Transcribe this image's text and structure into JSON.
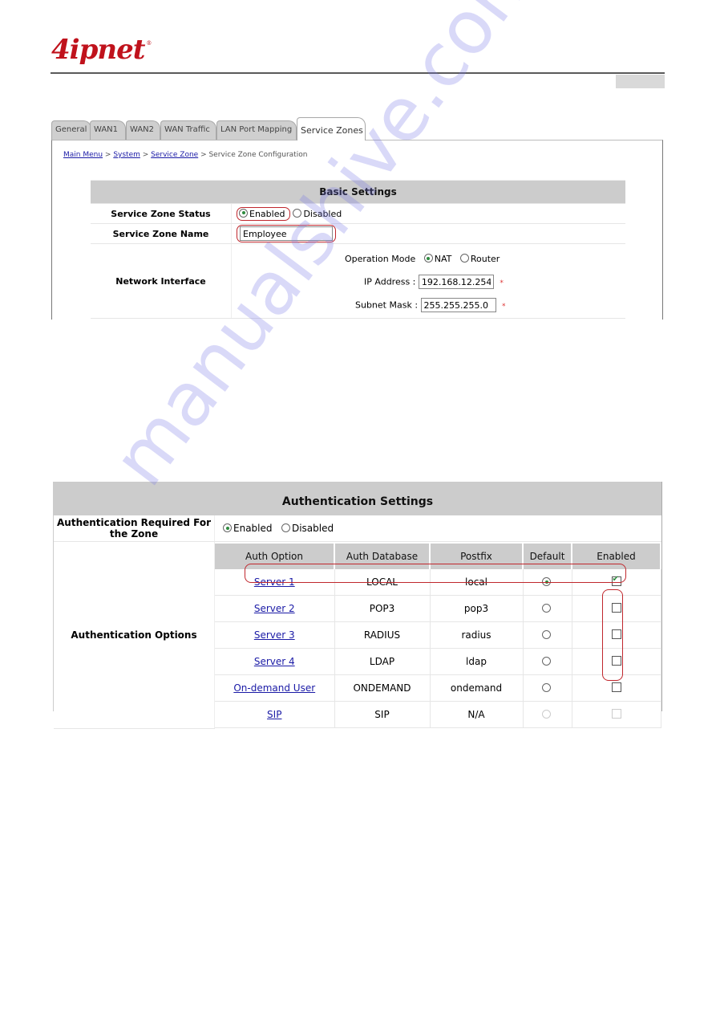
{
  "header": {
    "logo_text": "4ipnet",
    "logo_mark": "®",
    "brand_color": "#c0121c"
  },
  "screen1": {
    "tabs": [
      {
        "label": "General",
        "active": false
      },
      {
        "label": "WAN1",
        "active": false
      },
      {
        "label": "WAN2",
        "active": false
      },
      {
        "label": "WAN Traffic",
        "active": false
      },
      {
        "label": "LAN Port Mapping",
        "active": false
      },
      {
        "label": "Service Zones",
        "active": true
      }
    ],
    "breadcrumb": {
      "links": [
        "Main Menu",
        "System",
        "Service Zone"
      ],
      "separator": " > ",
      "current": "Service Zone Configuration"
    },
    "basic_settings": {
      "title": "Basic Settings",
      "status": {
        "label": "Service Zone Status",
        "options": [
          "Enabled",
          "Disabled"
        ],
        "selected": "Enabled"
      },
      "name": {
        "label": "Service Zone Name",
        "value": "Employee"
      },
      "network": {
        "label": "Network Interface",
        "operation_mode_label": "Operation Mode",
        "operation_mode_options": [
          "NAT",
          "Router"
        ],
        "operation_mode_selected": "NAT",
        "ip_label": "IP Address :",
        "ip_value": "192.168.12.254",
        "mask_label": "Subnet Mask :",
        "mask_value": "255.255.255.0",
        "required_mark": "*"
      }
    }
  },
  "screen2": {
    "title": "Authentication Settings",
    "required": {
      "label": "Authentication Required For the Zone",
      "options": [
        "Enabled",
        "Disabled"
      ],
      "selected": "Enabled"
    },
    "options_label": "Authentication Options",
    "columns": [
      "Auth Option",
      "Auth Database",
      "Postfix",
      "Default",
      "Enabled"
    ],
    "rows": [
      {
        "option": "Server 1",
        "database": "LOCAL",
        "postfix": "local",
        "default": true,
        "enabled": true,
        "disabled": false
      },
      {
        "option": "Server 2",
        "database": "POP3",
        "postfix": "pop3",
        "default": false,
        "enabled": false,
        "disabled": false
      },
      {
        "option": "Server 3",
        "database": "RADIUS",
        "postfix": "radius",
        "default": false,
        "enabled": false,
        "disabled": false
      },
      {
        "option": "Server 4",
        "database": "LDAP",
        "postfix": "ldap",
        "default": false,
        "enabled": false,
        "disabled": false
      },
      {
        "option": "On-demand User",
        "database": "ONDEMAND",
        "postfix": "ondemand",
        "default": false,
        "enabled": false,
        "disabled": false
      },
      {
        "option": "SIP",
        "database": "SIP",
        "postfix": "N/A",
        "default": false,
        "enabled": false,
        "disabled": true
      }
    ]
  },
  "watermark": "manualshive.com"
}
